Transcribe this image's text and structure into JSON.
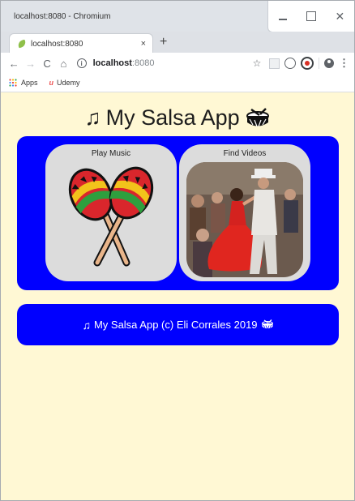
{
  "window": {
    "title": "localhost:8080 - Chromium",
    "controls": {
      "minimize": "",
      "maximize": "",
      "close": "✕"
    }
  },
  "tab": {
    "title": "localhost:8080",
    "close": "×",
    "new_tab": "+"
  },
  "toolbar": {
    "back": "←",
    "forward": "→",
    "reload": "C",
    "home": "⌂",
    "info": "i",
    "url_host": "localhost",
    "url_port": ":8080",
    "star": "☆",
    "menu": "⋮"
  },
  "bookmarks": [
    {
      "label": "Apps",
      "icon": "apps-grid-icon"
    },
    {
      "label": "Udemy",
      "icon": "udemy-icon",
      "logo": "u"
    }
  ],
  "page": {
    "title": "My Salsa App",
    "title_note_icon": "♫",
    "cards": [
      {
        "label": "Play Music",
        "image": "maracas-image"
      },
      {
        "label": "Find Videos",
        "image": "dancers-video-thumbnail"
      }
    ],
    "footer": {
      "note_icon": "♫",
      "text": "My Salsa App (c) Eli Corrales 2019"
    }
  },
  "colors": {
    "page_bg": "#fff8d4",
    "card_bg": "#0000ff",
    "tile_bg": "#dcdcdc"
  }
}
